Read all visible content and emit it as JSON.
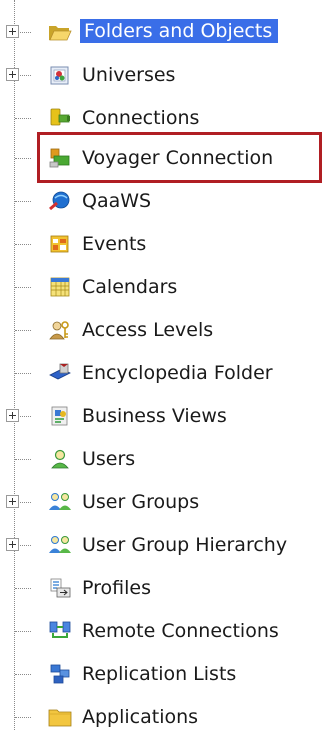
{
  "tree": {
    "items": [
      {
        "label": "Folders and Objects",
        "icon": "folder-open-icon",
        "expandable": true,
        "selected": true
      },
      {
        "label": "Universes",
        "icon": "universe-icon",
        "expandable": true
      },
      {
        "label": "Connections",
        "icon": "connection-icon",
        "expandable": false
      },
      {
        "label": "Voyager Connection",
        "icon": "voyager-connection-icon",
        "expandable": false,
        "highlighted": true
      },
      {
        "label": "QaaWS",
        "icon": "qaaws-icon",
        "expandable": false
      },
      {
        "label": "Events",
        "icon": "events-icon",
        "expandable": false
      },
      {
        "label": "Calendars",
        "icon": "calendar-icon",
        "expandable": false
      },
      {
        "label": "Access Levels",
        "icon": "access-levels-icon",
        "expandable": false
      },
      {
        "label": "Encyclopedia Folder",
        "icon": "encyclopedia-icon",
        "expandable": false
      },
      {
        "label": "Business Views",
        "icon": "business-views-icon",
        "expandable": true
      },
      {
        "label": "Users",
        "icon": "user-icon",
        "expandable": false
      },
      {
        "label": "User Groups",
        "icon": "user-groups-icon",
        "expandable": true
      },
      {
        "label": "User Group Hierarchy",
        "icon": "user-group-hierarchy-icon",
        "expandable": true
      },
      {
        "label": "Profiles",
        "icon": "profiles-icon",
        "expandable": false
      },
      {
        "label": "Remote Connections",
        "icon": "remote-connections-icon",
        "expandable": false
      },
      {
        "label": "Replication Lists",
        "icon": "replication-lists-icon",
        "expandable": false
      },
      {
        "label": "Applications",
        "icon": "folder-icon",
        "expandable": false
      }
    ]
  },
  "colors": {
    "selection": "#3a6ee8",
    "highlight_box": "#b01e23"
  }
}
